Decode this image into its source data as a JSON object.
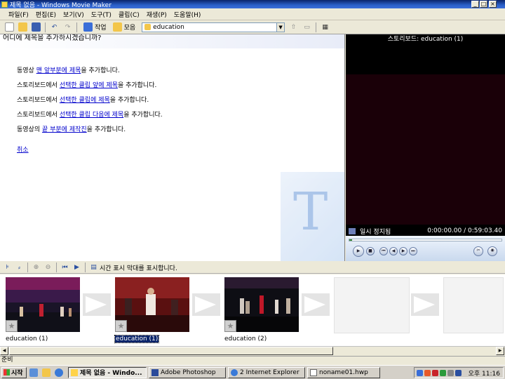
{
  "window": {
    "title": "제목 없음 - Windows Movie Maker"
  },
  "menu": [
    "파일(F)",
    "편집(E)",
    "보기(V)",
    "도구(T)",
    "클립(C)",
    "재생(P)",
    "도움말(H)"
  ],
  "toolbar": {
    "tasks_label": "작업",
    "collections_label": "모음",
    "collection_value": "education"
  },
  "taskpane": {
    "heading": "어디에 제목을 추가하시겠습니까?",
    "options": [
      {
        "prefix": "동영상 ",
        "link": "맨 앞부분에 제목",
        "suffix": "을 추가합니다."
      },
      {
        "prefix": "스토리보드에서 ",
        "link": "선택한 클립 앞에 제목",
        "suffix": "을 추가합니다."
      },
      {
        "prefix": "스토리보드에서 ",
        "link": "선택한 클립에 제목",
        "suffix": "을 추가합니다."
      },
      {
        "prefix": "스토리보드에서 ",
        "link": "선택한 클립 다음에 제목",
        "suffix": "을 추가합니다."
      },
      {
        "prefix": "동영상의 ",
        "link": "끝 부분에 제작진",
        "suffix": "을 추가합니다."
      }
    ],
    "cancel": "취소",
    "watermark_glyph": "T"
  },
  "monitor": {
    "title": "스토리보드: education (1)",
    "status": "일시 정지됨",
    "time": "0:00:00.00 / 0:59:03.40",
    "progress": 0.02
  },
  "storyboard_toolbar": {
    "toggle_label": "시간 표시 막대를 표시합니다."
  },
  "storyboard": {
    "clips": [
      {
        "label": "education (1)",
        "selected": false
      },
      {
        "label": "education (1)",
        "selected": true
      },
      {
        "label": "education (2)",
        "selected": false
      }
    ]
  },
  "statusbar": {
    "text": "준비"
  },
  "taskbar": {
    "start": "시작",
    "buttons": [
      "제목 없음 - Windo...",
      "Adobe Photoshop",
      "2 Internet Explorer",
      "noname01.hwp"
    ],
    "clock": "오후 11:16"
  }
}
